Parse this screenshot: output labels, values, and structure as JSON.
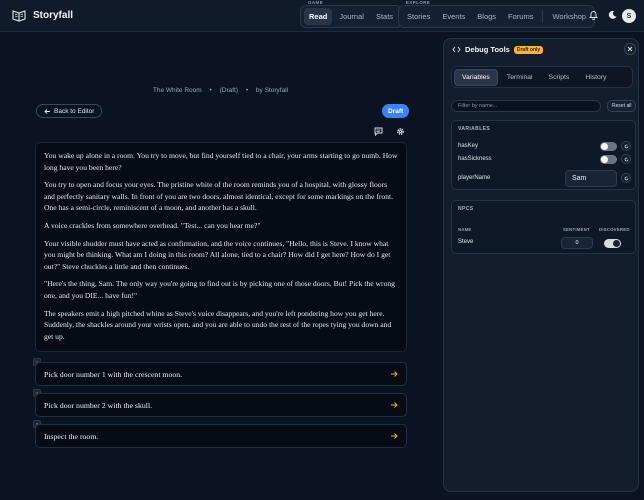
{
  "app": {
    "name": "Storyfall"
  },
  "nav": {
    "game_label": "GAME",
    "explore_label": "EXPLORE",
    "game_items": [
      "Read",
      "Journal",
      "Stats"
    ],
    "explore_items": [
      "Stories",
      "Events",
      "Blogs",
      "Forums"
    ],
    "workshop": "Workshop",
    "active": "Read"
  },
  "story": {
    "title": "The White Room",
    "status": "(Draft)",
    "author": "by Storyfall",
    "back_label": "Back to Editor",
    "draft_label": "Draft",
    "paragraphs": [
      "You wake up alone in a room. You try to move, but find yourself tied to a chair, your arms starting to go numb. How long have you been here?",
      "You try to open and focus your eyes. The pristine white of the room reminds you of a hospital, with glossy floors and perfectly sanitary walls. In front of you are two doors, almost identical, except for some markings on the front. One has a semi-circle, reminiscent of a moon, and another has a skull.",
      "A voice crackles from somewhere overhead. \"Test... can you hear me?\"",
      "Your visible shudder must have acted as confirmation, and the voice continues, \"Hello, this is Steve. I know what you might be thinking. What am I doing in this room? All alone, tied to a chair? How did I get here? How do I get out?\" Steve chuckles a little and then continues.",
      "\"Here's the thing, Sam. The only way you're going to find out is by picking one of those doors. But! Pick the wrong one, and you DIE... have fun!\"",
      "The speakers emit a high pitched whine as Steve's voice disappears, and you're left pondering how you get here. Suddenly, the shackles around your wrists open, and you are able to undo the rest of the ropes tying you down and get up."
    ],
    "choices": [
      {
        "num": "1",
        "label": "Pick door number 1 with the crescent moon."
      },
      {
        "num": "2",
        "label": "Pick door number 2 with the skull."
      },
      {
        "num": "3",
        "label": "Inspect the room."
      }
    ]
  },
  "debug": {
    "title": "Debug Tools",
    "badge": "Draft only",
    "tabs": [
      "Variables",
      "Terminal",
      "Scripts",
      "History"
    ],
    "active_tab": "Variables",
    "filter_placeholder": "Filter by name...",
    "reset_label": "Reset all",
    "variables_title": "VARIABLES",
    "variables": [
      {
        "name": "hasKey",
        "type": "bool",
        "value": false
      },
      {
        "name": "hasSickness",
        "type": "bool",
        "value": false
      },
      {
        "name": "playerName",
        "type": "text",
        "value": "Sam"
      }
    ],
    "npcs_title": "NPCS",
    "npc_columns": {
      "name": "NAME",
      "sentiment": "SENTIMENT",
      "discovered": "DISCOVERED"
    },
    "npcs": [
      {
        "name": "Steve",
        "sentiment": "0",
        "discovered": true
      }
    ]
  },
  "user": {
    "avatar_initial": "S"
  }
}
